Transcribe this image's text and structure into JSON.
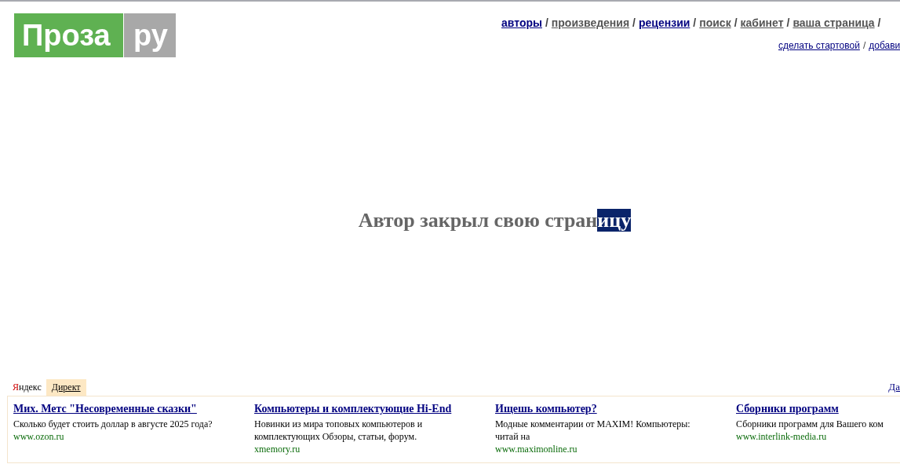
{
  "logo": {
    "left": "Проза",
    "right": "ру"
  },
  "nav": [
    {
      "label": "авторы",
      "visited": false
    },
    {
      "label": "произведения",
      "visited": true
    },
    {
      "label": "рецензии",
      "visited": false
    },
    {
      "label": "поиск",
      "visited": true
    },
    {
      "label": "кабинет",
      "visited": true
    },
    {
      "label": "ваша страница",
      "visited": true
    }
  ],
  "nav_separator": "/",
  "sub_nav": [
    "сделать стартовой",
    "добави"
  ],
  "heading": {
    "parts": [
      {
        "text": "Автор закрыл свою стран",
        "selected": false
      },
      {
        "text": "ицу",
        "selected": true
      }
    ]
  },
  "ads": {
    "brand_first": "Я",
    "brand_rest": "ндекс",
    "tab": "Директ",
    "corner_link": "Да",
    "items": [
      {
        "title": "Мих. Метс \"Несовременные сказки\"",
        "text": "Сколько будет стоить доллар в августе 2025 года?",
        "url": "www.ozon.ru"
      },
      {
        "title": "Компьютеры и комплектующие Hi-End",
        "text": "Новинки из мира топовых компьютеров и комплектующих Обзоры, статьи, форум.",
        "url": "xmemory.ru"
      },
      {
        "title": "Ищешь компьютер?",
        "text": "Модные комментарии от MAXIM! Компьютеры: читай на",
        "url": "www.maximonline.ru"
      },
      {
        "title": "Сборники программ",
        "text": "Сборники программ для Вашего ком",
        "url": "www.interlink-media.ru"
      }
    ]
  }
}
